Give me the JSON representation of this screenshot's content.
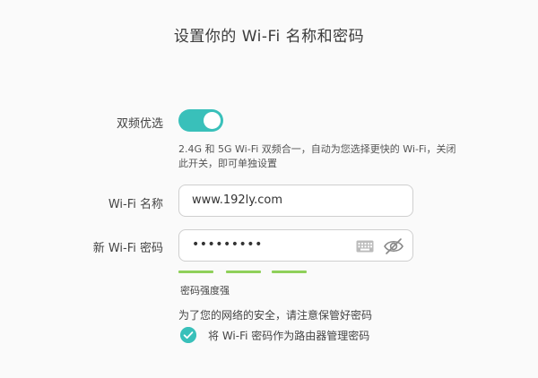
{
  "page": {
    "title": "设置你的 Wi-Fi 名称和密码"
  },
  "dual_band": {
    "label": "双频优选",
    "enabled": true,
    "hint": "2.4G 和 5G Wi-Fi 双频合一，自动为您选择更快的 Wi-Fi，关闭此开关，即可单独设置"
  },
  "wifi_name": {
    "label": "Wi-Fi 名称",
    "value": "www.192ly.com"
  },
  "wifi_password": {
    "label": "新 Wi-Fi 密码",
    "masked_value": "•••••••••",
    "keyboard_icon": "keyboard-icon",
    "visibility_icon": "eye-hidden-icon"
  },
  "strength": {
    "filled_segments": 3,
    "total_segments": 3,
    "label": "密码强度强",
    "color": "#8fd05a"
  },
  "safety_note": "为了您的网络的安全，请注意保管好密码",
  "admin_password_option": {
    "checked": true,
    "label": "将 Wi-Fi 密码作为路由器管理密码"
  },
  "colors": {
    "accent": "#39c0ba",
    "strength": "#8fd05a"
  }
}
